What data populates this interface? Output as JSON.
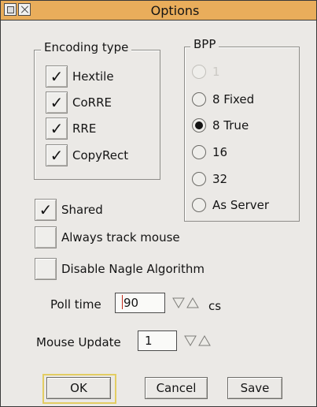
{
  "window": {
    "title": "Options"
  },
  "encoding": {
    "label": "Encoding type",
    "options": [
      {
        "label": "Hextile",
        "checked": true
      },
      {
        "label": "CoRRE",
        "checked": true
      },
      {
        "label": "RRE",
        "checked": true
      },
      {
        "label": "CopyRect",
        "checked": true
      }
    ]
  },
  "bpp": {
    "label": "BPP",
    "options": [
      {
        "label": "1",
        "selected": false,
        "disabled": true
      },
      {
        "label": "8 Fixed",
        "selected": false,
        "disabled": false
      },
      {
        "label": "8 True",
        "selected": true,
        "disabled": false
      },
      {
        "label": "16",
        "selected": false,
        "disabled": false
      },
      {
        "label": "32",
        "selected": false,
        "disabled": false
      },
      {
        "label": "As Server",
        "selected": false,
        "disabled": false
      }
    ]
  },
  "options": {
    "shared": {
      "label": "Shared",
      "checked": true
    },
    "track_mouse": {
      "label": "Always track mouse",
      "checked": false
    },
    "disable_nagle": {
      "label": "Disable Nagle Algorithm",
      "checked": false
    }
  },
  "poll": {
    "label": "Poll time",
    "value": "90",
    "unit": "cs"
  },
  "mouse_update": {
    "label": "Mouse Update",
    "value": "1"
  },
  "buttons": {
    "ok": "OK",
    "cancel": "Cancel",
    "save": "Save"
  },
  "check_mark": "✓",
  "colors": {
    "titlebar": "#e9ad5b",
    "default_button_frame": "#e3cd63",
    "caret": "#c22a1a"
  }
}
